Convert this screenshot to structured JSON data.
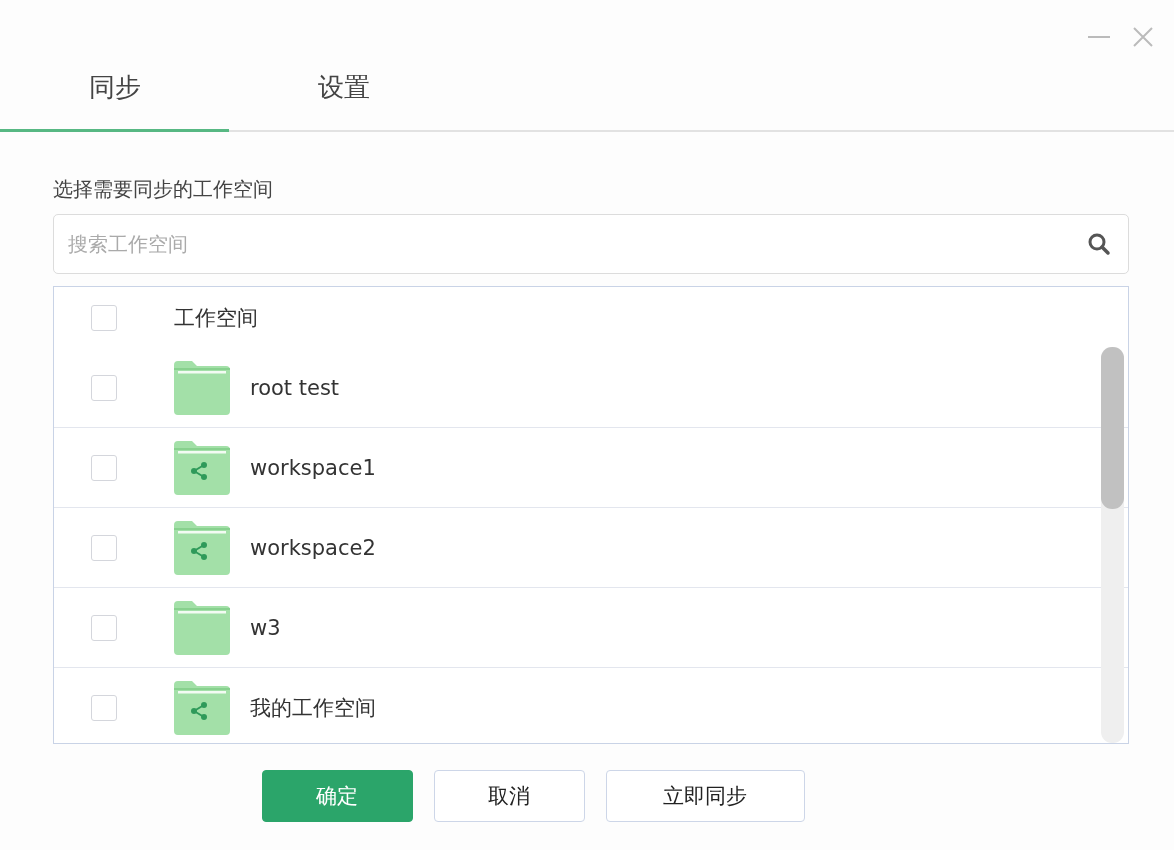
{
  "tabs": [
    {
      "label": "同步",
      "selected": true
    },
    {
      "label": "设置",
      "selected": false
    }
  ],
  "section_label": "选择需要同步的工作空间",
  "search": {
    "placeholder": "搜索工作空间"
  },
  "list": {
    "header": {
      "label": "工作空间",
      "checked": false
    },
    "rows": [
      {
        "name": "root test",
        "kind": "folder",
        "checked": false
      },
      {
        "name": "workspace1",
        "kind": "shared",
        "checked": false
      },
      {
        "name": "workspace2",
        "kind": "shared",
        "checked": false
      },
      {
        "name": "w3",
        "kind": "folder",
        "checked": false
      },
      {
        "name": "我的工作空间",
        "kind": "shared",
        "checked": false
      }
    ]
  },
  "buttons": [
    {
      "label": "确定",
      "kind": "primary"
    },
    {
      "label": "取消",
      "kind": "default"
    },
    {
      "label": "立即同步",
      "kind": "default"
    }
  ]
}
